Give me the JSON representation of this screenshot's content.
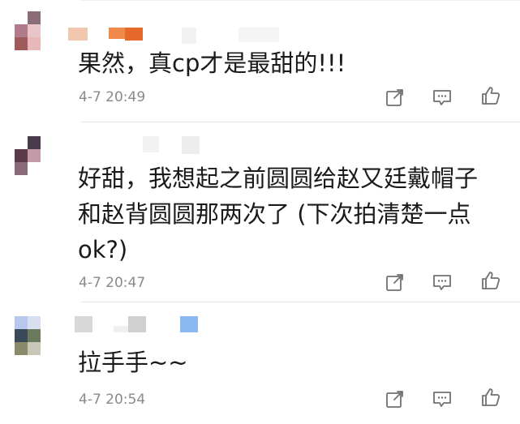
{
  "comments": [
    {
      "text": "果然，真cp才是最甜的!!!",
      "time": "4-7 20:49",
      "avatar_colors": [
        "#ffffff",
        "#8a6d78",
        "#ffffff",
        "#b07c8c",
        "#e9c5c8",
        "#ffffff",
        "#a05a5c",
        "#e8b8b8",
        "#ffffff"
      ],
      "name_colors": [
        "#f0c8b0",
        "#f08a4a",
        "#e56a2a",
        "#f2f2f2",
        "#f5f5f5"
      ]
    },
    {
      "text": "好甜，我想起之前圆圆给赵又廷戴帽子和赵背圆圆那两次了 (下次拍清楚一点ok?)",
      "time": "4-7 20:47",
      "avatar_colors": [
        "#ffffff",
        "#4a3a4e",
        "#ffffff",
        "#5a3a48",
        "#c49aa8",
        "#ffffff",
        "#8a6a78",
        "#ffffff",
        "#ffffff"
      ],
      "name_colors": [
        "#f2f2f2",
        "#ececec",
        "#f4f4f4"
      ]
    },
    {
      "text": "拉手手~~",
      "time": "4-7 20:54",
      "avatar_colors": [
        "#b8c8ec",
        "#d8dff0",
        "#ffffff",
        "#3a4a58",
        "#6a7a5a",
        "#ffffff",
        "#8a8a6a",
        "#c8c8b8",
        "#ffffff"
      ],
      "name_colors": [
        "#d8d8d8",
        "#f0f0f0",
        "#d0d0d0",
        "#8ab8f0"
      ]
    }
  ],
  "icons": {
    "share": "share-icon",
    "comment": "comment-icon",
    "like": "like-icon"
  },
  "colors": {
    "text": "#1a1a1a",
    "time": "#8a8a8a",
    "icon": "#707070",
    "divider": "#e6e6e6"
  }
}
